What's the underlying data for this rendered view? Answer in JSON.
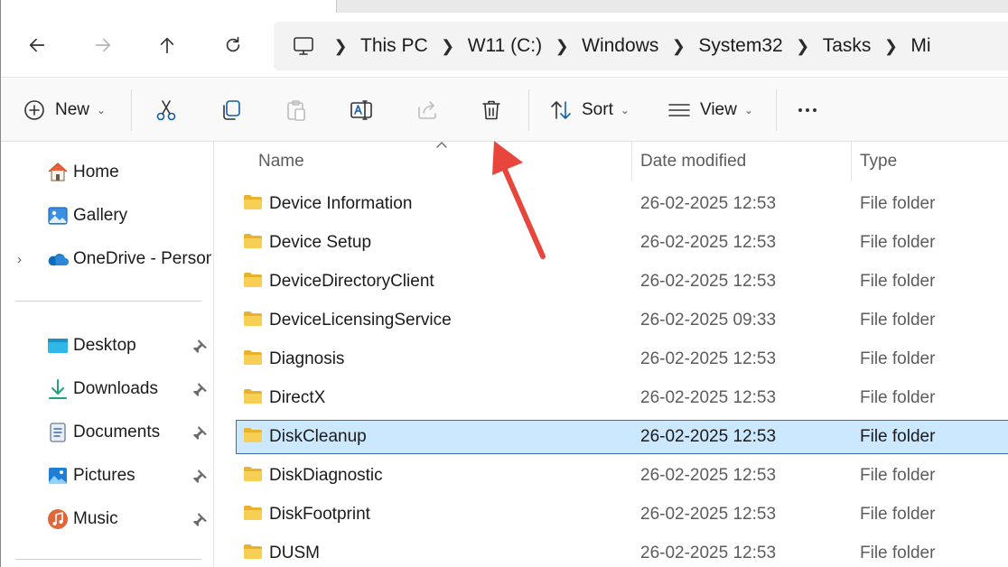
{
  "navigation": {
    "breadcrumbs": [
      "This PC",
      "W11 (C:)",
      "Windows",
      "System32",
      "Tasks",
      "Mi"
    ]
  },
  "commands": {
    "new_label": "New",
    "sort_label": "Sort",
    "view_label": "View"
  },
  "sidebar": {
    "top_items": [
      {
        "label": "Home",
        "icon": "home-icon"
      },
      {
        "label": "Gallery",
        "icon": "gallery-icon"
      },
      {
        "label": "OneDrive - Personal",
        "icon": "onedrive-icon"
      }
    ],
    "pinned_items": [
      {
        "label": "Desktop",
        "icon": "desktop-folder-icon"
      },
      {
        "label": "Downloads",
        "icon": "downloads-folder-icon"
      },
      {
        "label": "Documents",
        "icon": "documents-folder-icon"
      },
      {
        "label": "Pictures",
        "icon": "pictures-folder-icon"
      },
      {
        "label": "Music",
        "icon": "music-folder-icon"
      }
    ]
  },
  "columns": {
    "name": "Name",
    "date_modified": "Date modified",
    "type": "Type"
  },
  "files": [
    {
      "name": "Device Information",
      "date": "26-02-2025 12:53",
      "type": "File folder",
      "selected": false
    },
    {
      "name": "Device Setup",
      "date": "26-02-2025 12:53",
      "type": "File folder",
      "selected": false
    },
    {
      "name": "DeviceDirectoryClient",
      "date": "26-02-2025 12:53",
      "type": "File folder",
      "selected": false
    },
    {
      "name": "DeviceLicensingService",
      "date": "26-02-2025 09:33",
      "type": "File folder",
      "selected": false
    },
    {
      "name": "Diagnosis",
      "date": "26-02-2025 12:53",
      "type": "File folder",
      "selected": false
    },
    {
      "name": "DirectX",
      "date": "26-02-2025 12:53",
      "type": "File folder",
      "selected": false
    },
    {
      "name": "DiskCleanup",
      "date": "26-02-2025 12:53",
      "type": "File folder",
      "selected": true
    },
    {
      "name": "DiskDiagnostic",
      "date": "26-02-2025 12:53",
      "type": "File folder",
      "selected": false
    },
    {
      "name": "DiskFootprint",
      "date": "26-02-2025 12:53",
      "type": "File folder",
      "selected": false
    },
    {
      "name": "DUSM",
      "date": "26-02-2025 12:53",
      "type": "File folder",
      "selected": false
    }
  ],
  "colors": {
    "selection_fill": "#cce8ff",
    "selection_border": "#3a6ea5",
    "annotation_arrow": "#e8453c",
    "folder": "#f5c542"
  }
}
